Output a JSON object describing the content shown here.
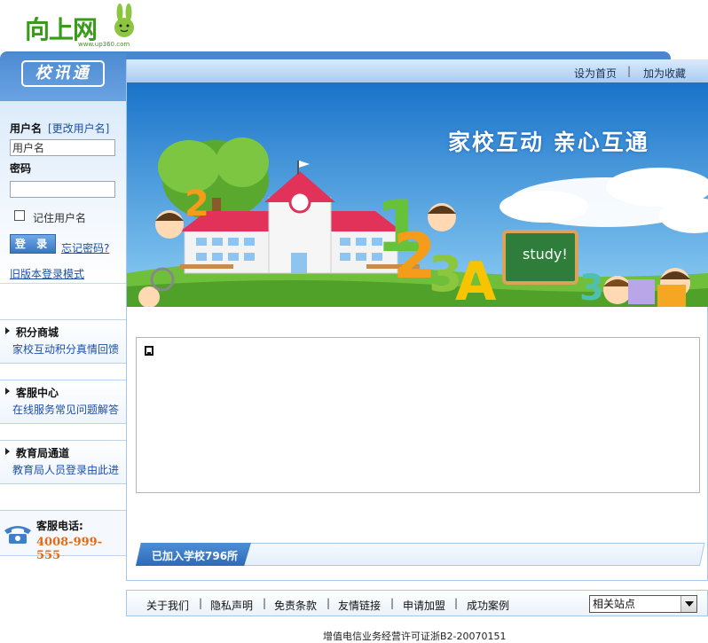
{
  "logo": {
    "text": "向上网",
    "url_text": "www.up360.com"
  },
  "sidebar": {
    "header_title": "校讯通",
    "login": {
      "username_label": "用户名",
      "change_username": "[更改用户名]",
      "username_value": "用户名",
      "password_label": "密码",
      "password_value": "",
      "remember_label": "记住用户名",
      "login_button": "登 录",
      "forgot_password": "忘记密码?",
      "old_version": "旧版本登录模式"
    },
    "sections": [
      {
        "title": "积分商城",
        "subtitle": "家校互动积分真情回馈"
      },
      {
        "title": "客服中心",
        "subtitle": "在线服务常见问题解答"
      },
      {
        "title": "教育局通道",
        "subtitle": "教育局人员登录由此进"
      }
    ],
    "hotline": {
      "label": "客服电话:",
      "number": "4008-999-555"
    }
  },
  "main": {
    "top_links": {
      "set_homepage": "设为首页",
      "separator": "|",
      "add_favorite": "加为收藏"
    },
    "banner": {
      "slogan": "家校互动  亲心互通",
      "chalkboard_text": "study!"
    },
    "school_count": "已加入学校796所"
  },
  "footer": {
    "links": [
      "关于我们",
      "隐私声明",
      "免责条款",
      "友情链接",
      "申请加盟",
      "成功案例"
    ],
    "separator": "|",
    "related_sites": "相关站点",
    "license": "增值电信业务经营许可证浙B2-20070151"
  },
  "colors": {
    "brand_blue": "#4a86cc",
    "link_blue": "#1c4fa8",
    "logo_green": "#3a9a1a",
    "hotline_orange": "#e56a12"
  }
}
